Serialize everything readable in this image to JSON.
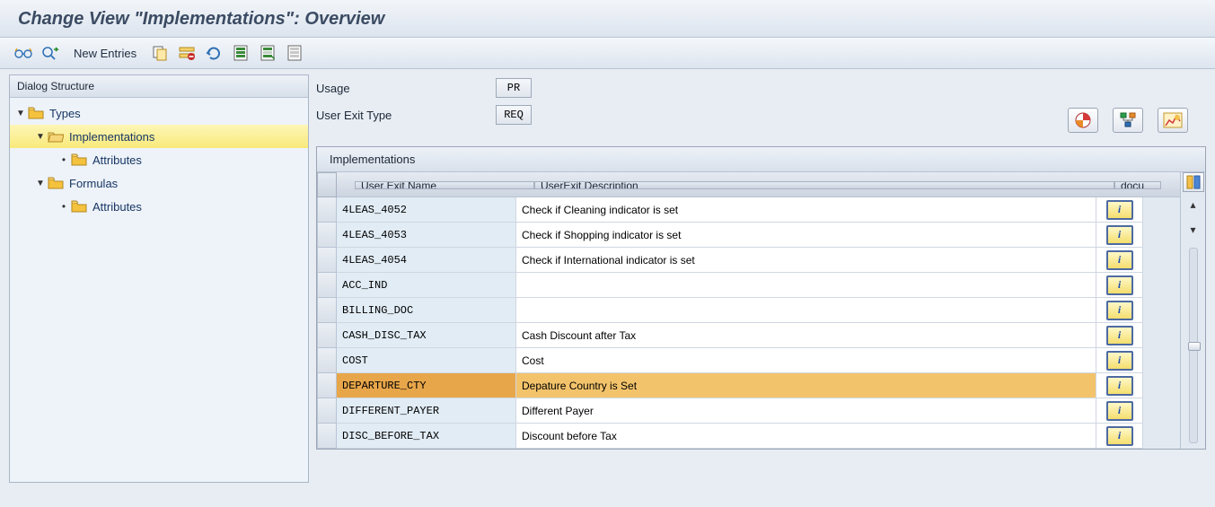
{
  "header": {
    "title": "Change View \"Implementations\": Overview"
  },
  "toolbar": {
    "new_entries": "New Entries"
  },
  "dialog_structure": {
    "title": "Dialog Structure",
    "nodes": {
      "types": "Types",
      "implementations": "Implementations",
      "attributes1": "Attributes",
      "formulas": "Formulas",
      "attributes2": "Attributes"
    }
  },
  "form": {
    "usage_label": "Usage",
    "usage_value": "PR",
    "user_exit_type_label": "User Exit Type",
    "user_exit_type_value": "REQ"
  },
  "table": {
    "title": "Implementations",
    "col_name": "User Exit Name",
    "col_desc": "UserExit Description",
    "col_docu": "docu",
    "rows": [
      {
        "name": "4LEAS_4052",
        "desc": "Check if Cleaning indicator is set"
      },
      {
        "name": "4LEAS_4053",
        "desc": "Check if Shopping indicator is set"
      },
      {
        "name": "4LEAS_4054",
        "desc": "Check if International indicator is set"
      },
      {
        "name": "ACC_IND",
        "desc": ""
      },
      {
        "name": "BILLING_DOC",
        "desc": ""
      },
      {
        "name": "CASH_DISC_TAX",
        "desc": "Cash Discount after Tax"
      },
      {
        "name": "COST",
        "desc": "Cost"
      },
      {
        "name": "DEPARTURE_CTY",
        "desc": "Depature Country is Set"
      },
      {
        "name": "DIFFERENT_PAYER",
        "desc": "Different Payer"
      },
      {
        "name": "DISC_BEFORE_TAX",
        "desc": "Discount before Tax"
      }
    ],
    "selected_index": 7
  }
}
